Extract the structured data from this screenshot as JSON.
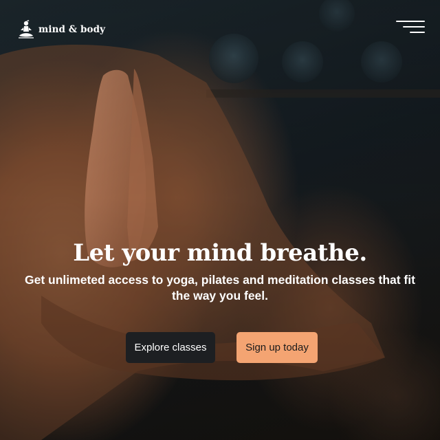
{
  "header": {
    "logo_text": "mind & body",
    "logo_icon": "meditating-figure-icon",
    "menu_icon": "hamburger-menu-icon"
  },
  "hero": {
    "headline": "Let your mind breathe.",
    "subtext": "Get unlimeted access to yoga, pilates and meditation classes that fit the way you feel.",
    "background_image": "person with palms pressed together in prayer pose"
  },
  "actions": {
    "explore_label": "Explore classes",
    "signup_label": "Sign up today"
  },
  "colors": {
    "primary_button": "#1d1f22",
    "accent_button": "#f4a472",
    "text": "#ffffff"
  }
}
